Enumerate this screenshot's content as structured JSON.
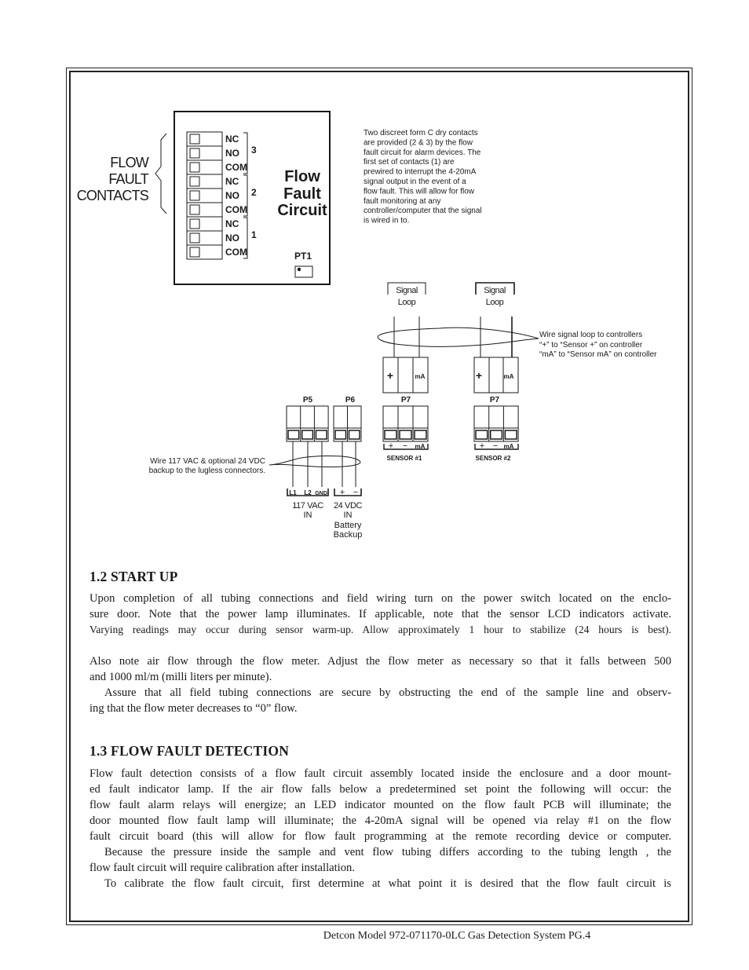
{
  "diagram": {
    "flow_fault_contacts_label": [
      "FLOW",
      "FAULT",
      "CONTACTS"
    ],
    "contacts": [
      "NC",
      "NO",
      "COM",
      "NC",
      "NO",
      "COM",
      "NC",
      "NO",
      "COM"
    ],
    "contact_groups": [
      "3",
      "2",
      "1"
    ],
    "circuit_title": [
      "Flow",
      "Fault",
      "Circuit"
    ],
    "pt1_label": "PT1",
    "note": [
      "Two discreet form C dry contacts",
      "are provided (2 & 3) by the flow",
      "fault circuit for alarm devices. The",
      "first set of contacts (1) are",
      "prewired to interrupt the 4-20mA",
      "signal output in the event of a",
      "flow fault. This will allow for flow",
      "fault monitoring at any",
      "controller/computer that the signal",
      "is wired in to."
    ],
    "signal_loop": [
      "Signal",
      "Loop"
    ],
    "signal_loop_note": [
      "Wire signal loop to controllers",
      "“+” to “Sensor +” on controller",
      "“mA” to “Sensor mA” on controller"
    ],
    "plus": "+",
    "minus": "−",
    "ma": "mA",
    "p5": "P5",
    "p6": "P6",
    "p7": "P7",
    "sensor1": "SENSOR #1",
    "sensor2": "SENSOR #2",
    "power_note": [
      "Wire 117 VAC & optional 24 VDC",
      "backup to the lugless connectors."
    ],
    "l1": "L1",
    "l2": "L2",
    "gnd": "GND",
    "vac_label": [
      "117 VAC",
      "IN"
    ],
    "vdc_label": [
      "24 VDC",
      "IN",
      "Battery",
      "Backup"
    ]
  },
  "section_1_2": {
    "heading": "1.2  START UP",
    "lines": [
      "Upon completion of all tubing connections and field wiring turn on the power switch located on the enclo-",
      "sure door. Note that the power lamp illuminates. If applicable, note that the sensor LCD indicators activate.",
      "Varying readings may occur during sensor warm-up. Allow approximately 1 hour to stabilize (24 hours is best).",
      "Also note air flow through the flow meter. Adjust the flow meter as necessary so that it falls between 500",
      "and 1000 ml/m (milli liters per minute).",
      "Assure that all field tubing connections are secure by obstructing the end of the sample line and observ-",
      "ing that the flow meter decreases to “0” flow."
    ]
  },
  "section_1_3": {
    "heading": "1.3  FLOW FAULT DETECTION",
    "lines": [
      "Flow fault detection consists of a flow fault circuit assembly located inside the enclosure and a door mount-",
      "ed fault indicator lamp. If the air flow falls below a predetermined set point the following will occur: the",
      "flow fault alarm relays will energize; an LED indicator mounted on the flow fault PCB  will illuminate; the",
      "door mounted flow fault lamp will illuminate; the 4-20mA signal will be opened via relay #1 on the flow",
      "fault circuit board (this will allow for flow fault programming at the remote recording device or computer.",
      "Because the pressure inside the sample and vent flow tubing differs according to the tubing length , the",
      "flow fault circuit will require calibration after installation.",
      "To calibrate the flow fault circuit, first determine at what point it is desired that the flow fault circuit is"
    ]
  },
  "footer": "Detcon Model 972-071170-0LC Gas Detection System   PG.4"
}
